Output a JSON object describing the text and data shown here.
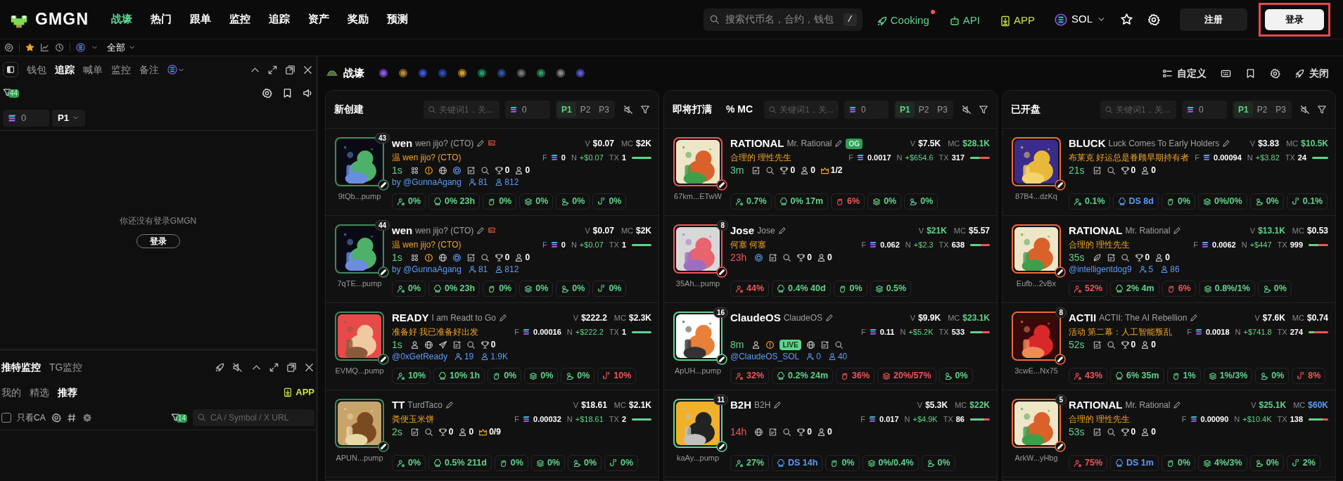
{
  "header": {
    "logo": "GMGN",
    "nav": [
      {
        "label": "战壕",
        "selected": true
      },
      {
        "label": "热门",
        "selected": false
      },
      {
        "label": "跟单",
        "selected": false
      },
      {
        "label": "监控",
        "selected": false
      },
      {
        "label": "追踪",
        "selected": false
      },
      {
        "label": "资产",
        "selected": false
      },
      {
        "label": "奖励",
        "selected": false
      },
      {
        "label": "预测",
        "selected": false
      }
    ],
    "search": {
      "placeholder": "搜索代币名，合约，钱包",
      "shortcut": "/"
    },
    "links": [
      {
        "kind": "cooking",
        "label": "Cooking",
        "dot": true
      },
      {
        "kind": "api",
        "label": "API",
        "dot": false
      },
      {
        "kind": "app",
        "label": "APP",
        "dot": false
      }
    ],
    "chain": "SOL",
    "register": "注册",
    "login": {
      "label": "登录",
      "highlighted": true
    }
  },
  "subbar": {
    "filter": "全部"
  },
  "left_panel": {
    "tabs": [
      {
        "label": "钱包",
        "selected": false
      },
      {
        "label": "追踪",
        "selected": true
      },
      {
        "label": "喊单",
        "selected": false
      },
      {
        "label": "监控",
        "selected": false
      },
      {
        "label": "备注",
        "selected": false
      }
    ],
    "filter_count": "44",
    "amount": "0",
    "page": "P1",
    "message": "你还没有登录GMGN",
    "login_button": "登录"
  },
  "monitor_panel": {
    "tabs": [
      {
        "label": "推特监控",
        "selected": true
      },
      {
        "label": "TG监控",
        "selected": false
      }
    ],
    "subtabs": [
      {
        "label": "我的",
        "selected": false
      },
      {
        "label": "精选",
        "selected": false
      },
      {
        "label": "推荐",
        "selected": true
      }
    ],
    "app": "APP",
    "only_ca": {
      "label": "只看CA",
      "checked": false
    },
    "filter_count": "14",
    "search_placeholder": "CA / Symbol / X URL"
  },
  "main": {
    "title": "战壕",
    "actions": [
      {
        "kind": "customize",
        "label": "自定义"
      },
      {
        "kind": "keyboard"
      },
      {
        "kind": "bookmark"
      },
      {
        "kind": "settings"
      },
      {
        "kind": "close",
        "label": "关闭"
      }
    ],
    "columns": [
      {
        "title": "新创建",
        "search_placeholder": "关键词1，关...",
        "amount": "0",
        "pages": [
          {
            "label": "P1",
            "selected": true
          },
          {
            "label": "P2",
            "selected": false
          },
          {
            "label": "P3",
            "selected": false
          }
        ],
        "cards": [
          {
            "count": "43",
            "color": "#3f8a5c",
            "ticker": "wen",
            "name": "wen jijo? (CTO)",
            "flag": true,
            "subtitle": "温 wen jijo?  (CTO)",
            "age": {
              "text": "1s",
              "color": "#5fd38d"
            },
            "stats": [
              {
                "kind": "holders"
              },
              {
                "kind": "warn"
              },
              {
                "kind": "web"
              },
              {
                "kind": "coin"
              },
              {
                "kind": "post"
              },
              {
                "kind": "search"
              },
              {
                "kind": "trophy",
                "value": "0"
              },
              {
                "kind": "person",
                "value": "0"
              }
            ],
            "handle": "by @GunnaAgang",
            "followers": [
              "81",
              "812"
            ],
            "v": {
              "label": "V",
              "text": "$0.07",
              "color": "#ffffff"
            },
            "mc": {
              "label": "MC",
              "text": "$2K",
              "color": "#ffffff"
            },
            "f": {
              "label": "F",
              "text": "0"
            },
            "n": {
              "label": "N",
              "text": "+$0.07"
            },
            "tx": {
              "label": "TX",
              "text": "1"
            },
            "level": 1,
            "address": "9tQb...pump",
            "chips": [
              {
                "kind": "holders",
                "text": "0%",
                "color": "#5fd38d"
              },
              {
                "kind": "hat",
                "text": "0% 23h",
                "color": "#5fd38d"
              },
              {
                "kind": "fist",
                "text": "0%",
                "color": "#5fd38d"
              },
              {
                "kind": "layers",
                "text": "0%",
                "color": "#5fd38d"
              },
              {
                "kind": "rat",
                "text": "0%",
                "color": "#5fd38d"
              },
              {
                "kind": "hook",
                "text": "0%",
                "color": "#5fd38d"
              }
            ]
          },
          {
            "count": "44",
            "color": "#3f8a5c",
            "ticker": "wen",
            "name": "wen jijo? (CTO)",
            "flag": true,
            "subtitle": "温 wen jijo?  (CTO)",
            "age": {
              "text": "1s",
              "color": "#5fd38d"
            },
            "stats": [
              {
                "kind": "holders"
              },
              {
                "kind": "warn"
              },
              {
                "kind": "web"
              },
              {
                "kind": "coin"
              },
              {
                "kind": "post"
              },
              {
                "kind": "search"
              },
              {
                "kind": "trophy",
                "value": "0"
              },
              {
                "kind": "person",
                "value": "0"
              }
            ],
            "handle": "by @GunnaAgang",
            "followers": [
              "81",
              "812"
            ],
            "v": {
              "label": "V",
              "text": "$0.07",
              "color": "#ffffff"
            },
            "mc": {
              "label": "MC",
              "text": "$2K",
              "color": "#ffffff"
            },
            "f": {
              "label": "F",
              "text": "0"
            },
            "n": {
              "label": "N",
              "text": "+$0.07"
            },
            "tx": {
              "label": "TX",
              "text": "1"
            },
            "level": 1,
            "address": "7qTE...pump",
            "chips": [
              {
                "kind": "holders",
                "text": "0%",
                "color": "#5fd38d"
              },
              {
                "kind": "hat",
                "text": "0% 23h",
                "color": "#5fd38d"
              },
              {
                "kind": "fist",
                "text": "0%",
                "color": "#5fd38d"
              },
              {
                "kind": "layers",
                "text": "0%",
                "color": "#5fd38d"
              },
              {
                "kind": "rat",
                "text": "0%",
                "color": "#5fd38d"
              },
              {
                "kind": "hook",
                "text": "0%",
                "color": "#5fd38d"
              }
            ]
          },
          {
            "color": "#3f8a5c",
            "ticker": "READY",
            "name": "I am Readt to Go",
            "flag": false,
            "subtitle": "准备好 我已准备好出发",
            "age": {
              "text": "1s",
              "color": "#5fd38d"
            },
            "stats": [
              {
                "kind": "person"
              },
              {
                "kind": "web"
              },
              {
                "kind": "telegram"
              },
              {
                "kind": "post"
              },
              {
                "kind": "search"
              },
              {
                "kind": "trophy",
                "value": "0"
              }
            ],
            "handle": "@0xGetReady",
            "followers": [
              "19",
              "1.9K"
            ],
            "v": {
              "label": "V",
              "text": "$222.2",
              "color": "#ffffff"
            },
            "mc": {
              "label": "MC",
              "text": "$2.3K",
              "color": "#ffffff"
            },
            "f": {
              "label": "F",
              "text": "0.00016"
            },
            "n": {
              "label": "N",
              "text": "+$222.2"
            },
            "tx": {
              "label": "TX",
              "text": "1"
            },
            "level": 1,
            "address": "EVMQ...pump",
            "chips": [
              {
                "kind": "holders",
                "text": "10%",
                "color": "#5fd38d"
              },
              {
                "kind": "hat",
                "text": "10% 1h",
                "color": "#5fd38d"
              },
              {
                "kind": "fist",
                "text": "0%",
                "color": "#5fd38d"
              },
              {
                "kind": "layers",
                "text": "0%",
                "color": "#5fd38d"
              },
              {
                "kind": "rat",
                "text": "0%",
                "color": "#5fd38d"
              },
              {
                "kind": "hook",
                "text": "10%",
                "color": "#f0555a"
              }
            ]
          },
          {
            "color": "#3f8a5c",
            "ticker": "TT",
            "name": "TurdTaco",
            "flag": false,
            "subtitle": "粪便玉米饼",
            "age": {
              "text": "2s",
              "color": "#5fd38d"
            },
            "stats": [
              {
                "kind": "post"
              },
              {
                "kind": "search"
              },
              {
                "kind": "trophy",
                "value": "0"
              },
              {
                "kind": "person",
                "value": "0"
              },
              {
                "kind": "crown",
                "value": "0/9"
              }
            ],
            "v": {
              "label": "V",
              "text": "$18.61",
              "color": "#ffffff"
            },
            "mc": {
              "label": "MC",
              "text": "$2.1K",
              "color": "#ffffff"
            },
            "f": {
              "label": "F",
              "text": "0.00032"
            },
            "n": {
              "label": "N",
              "text": "+$18.61"
            },
            "tx": {
              "label": "TX",
              "text": "2"
            },
            "level": 1,
            "address": "APUN...pump",
            "chips": [
              {
                "kind": "holders",
                "text": "0%",
                "color": "#5fd38d"
              },
              {
                "kind": "hat",
                "text": "0.5% 211d",
                "color": "#5fd38d"
              },
              {
                "kind": "fist",
                "text": "0%",
                "color": "#5fd38d"
              },
              {
                "kind": "layers",
                "text": "0%",
                "color": "#5fd38d"
              },
              {
                "kind": "rat",
                "text": "0%",
                "color": "#5fd38d"
              },
              {
                "kind": "hook",
                "text": "0%",
                "color": "#5fd38d"
              }
            ]
          }
        ]
      },
      {
        "title": "即将打满",
        "extra": "% MC",
        "search_placeholder": "关键词1，关...",
        "amount": "0",
        "pages": [
          {
            "label": "P1",
            "selected": true
          },
          {
            "label": "P2",
            "selected": false
          },
          {
            "label": "P3",
            "selected": false
          }
        ],
        "cards": [
          {
            "color": "#f0555a",
            "ticker": "RATIONAL",
            "name": "Mr. Rational",
            "badge": "OG",
            "flag": false,
            "subtitle": "合理的 理性先生",
            "age": {
              "text": "3m",
              "color": "#5fd38d"
            },
            "stats": [
              {
                "kind": "post"
              },
              {
                "kind": "search"
              },
              {
                "kind": "trophy",
                "value": "0"
              },
              {
                "kind": "person",
                "value": "0"
              },
              {
                "kind": "crown",
                "value": "1/2"
              }
            ],
            "v": {
              "label": "V",
              "text": "$7.5K",
              "color": "#ffffff"
            },
            "mc": {
              "label": "MC",
              "text": "$28.1K",
              "color": "#5fd38d"
            },
            "f": {
              "label": "F",
              "text": "0.0017"
            },
            "n": {
              "label": "N",
              "text": "+$654.6"
            },
            "tx": {
              "label": "TX",
              "text": "317"
            },
            "level": 0.45,
            "address": "67km...ETwW",
            "chips": [
              {
                "kind": "holders",
                "text": "0.7%",
                "color": "#5fd38d"
              },
              {
                "kind": "hat",
                "text": "0% 17m",
                "color": "#5fd38d"
              },
              {
                "kind": "fist",
                "text": "6%",
                "color": "#f0555a"
              },
              {
                "kind": "layers",
                "text": "0%",
                "color": "#5fd38d"
              },
              {
                "kind": "rat",
                "text": "0%",
                "color": "#5fd38d"
              }
            ]
          },
          {
            "count": "8",
            "color": "#f0555a",
            "ticker": "Jose",
            "name": "Jose",
            "flag": false,
            "subtitle": "何塞 何塞",
            "age": {
              "text": "23h",
              "color": "#f0555a"
            },
            "stats": [
              {
                "kind": "coin"
              },
              {
                "kind": "post"
              },
              {
                "kind": "search"
              },
              {
                "kind": "trophy",
                "value": "0"
              },
              {
                "kind": "person",
                "value": "0"
              }
            ],
            "v": {
              "label": "V",
              "text": "$21K",
              "color": "#5fd38d"
            },
            "mc": {
              "label": "MC",
              "text": "$5.57",
              "color": "#ffffff"
            },
            "f": {
              "label": "F",
              "text": "0.062"
            },
            "n": {
              "label": "N",
              "text": "+$2.3"
            },
            "tx": {
              "label": "TX",
              "text": "638"
            },
            "level": 0.55,
            "address": "35Ah...pump",
            "chips": [
              {
                "kind": "holders",
                "text": "44%",
                "color": "#f0555a"
              },
              {
                "kind": "hat",
                "text": "0.4% 40d",
                "color": "#5fd38d"
              },
              {
                "kind": "fist",
                "text": "0%",
                "color": "#5fd38d"
              },
              {
                "kind": "layers",
                "text": "0.5%",
                "color": "#5fd38d"
              }
            ]
          },
          {
            "count": "16",
            "color": "#5fd38d",
            "ticker": "ClaudeOS",
            "name": "ClaudeOS",
            "flag": false,
            "age": {
              "text": "8m",
              "color": "#5fd38d"
            },
            "stats": [
              {
                "kind": "person"
              },
              {
                "kind": "warn"
              },
              {
                "kind": "live",
                "value": "LIVE"
              },
              {
                "kind": "web"
              },
              {
                "kind": "post"
              },
              {
                "kind": "search"
              }
            ],
            "handle": "@ClaudeOS_SOL",
            "followers": [
              "0",
              "40"
            ],
            "v": {
              "label": "V",
              "text": "$9.9K",
              "color": "#ffffff"
            },
            "mc": {
              "label": "MC",
              "text": "$23.1K",
              "color": "#5fd38d"
            },
            "f": {
              "label": "F",
              "text": "0.11"
            },
            "n": {
              "label": "N",
              "text": "+$5.2K"
            },
            "tx": {
              "label": "TX",
              "text": "533"
            },
            "level": 0.6,
            "address": "ApUH...pump",
            "chips": [
              {
                "kind": "holders",
                "text": "32%",
                "color": "#f0555a"
              },
              {
                "kind": "hat",
                "text": "0.2% 24m",
                "color": "#5fd38d"
              },
              {
                "kind": "fist",
                "text": "36%",
                "color": "#f0555a"
              },
              {
                "kind": "layers",
                "text": "20%/57%",
                "color": "#f0555a"
              },
              {
                "kind": "rat",
                "text": "0%",
                "color": "#5fd38d"
              }
            ]
          },
          {
            "count": "11",
            "color": "#5fd38d",
            "ticker": "B2H",
            "name": "B2H",
            "flag": false,
            "age": {
              "text": "14h",
              "color": "#f0555a"
            },
            "stats": [
              {
                "kind": "web"
              },
              {
                "kind": "post"
              },
              {
                "kind": "search"
              },
              {
                "kind": "trophy",
                "value": "0"
              },
              {
                "kind": "person",
                "value": "0"
              }
            ],
            "v": {
              "label": "V",
              "text": "$5.3K",
              "color": "#ffffff"
            },
            "mc": {
              "label": "MC",
              "text": "$22K",
              "color": "#5fd38d"
            },
            "f": {
              "label": "F",
              "text": "0.017"
            },
            "n": {
              "label": "N",
              "text": "+$4.9K"
            },
            "tx": {
              "label": "TX",
              "text": "86"
            },
            "level": 0.7,
            "address": "kaAy...pump",
            "chips": [
              {
                "kind": "holders",
                "text": "27%",
                "color": "#5fd38d"
              },
              {
                "kind": "hat",
                "text": "DS 14h",
                "color": "#5b9cf5"
              },
              {
                "kind": "fist",
                "text": "0%",
                "color": "#5fd38d"
              },
              {
                "kind": "layers",
                "text": "0%/0.4%",
                "color": "#5fd38d"
              },
              {
                "kind": "rat",
                "text": "0%",
                "color": "#5fd38d"
              }
            ]
          }
        ]
      },
      {
        "title": "已开盘",
        "search_placeholder": "关键词1，关...",
        "amount": "0",
        "pages": [
          {
            "label": "P1",
            "selected": true
          },
          {
            "label": "P2",
            "selected": false
          },
          {
            "label": "P3",
            "selected": false
          }
        ],
        "cards": [
          {
            "color": "#f06a3a",
            "ticker": "BLUCK",
            "name": "Luck Comes To Early Holders",
            "flag": false,
            "subtitle": "布莱克 好运总是眷顾早期持有者",
            "age": {
              "text": "21s",
              "color": "#5fd38d"
            },
            "stats": [
              {
                "kind": "post"
              },
              {
                "kind": "search"
              },
              {
                "kind": "trophy",
                "value": "0"
              },
              {
                "kind": "person",
                "value": "0"
              }
            ],
            "v": {
              "label": "V",
              "text": "$3.83",
              "color": "#ffffff"
            },
            "mc": {
              "label": "MC",
              "text": "$10.5K",
              "color": "#5fd38d"
            },
            "f": {
              "label": "F",
              "text": "0.00094"
            },
            "n": {
              "label": "N",
              "text": "+$3.82"
            },
            "tx": {
              "label": "TX",
              "text": "24"
            },
            "level": 1,
            "address": "87B4...dzKq",
            "chips": [
              {
                "kind": "holders",
                "text": "0.1%",
                "color": "#5fd38d"
              },
              {
                "kind": "hat",
                "text": "DS 8d",
                "color": "#5b9cf5"
              },
              {
                "kind": "fist",
                "text": "0%",
                "color": "#5fd38d"
              },
              {
                "kind": "layers",
                "text": "0%/0%",
                "color": "#5fd38d"
              },
              {
                "kind": "rat",
                "text": "0%",
                "color": "#5fd38d"
              },
              {
                "kind": "hook",
                "text": "0.1%",
                "color": "#5fd38d"
              }
            ]
          },
          {
            "color": "#f06a3a",
            "ticker": "RATIONAL",
            "name": "Mr. Rational",
            "flag": false,
            "subtitle": "合理的 理性先生",
            "age": {
              "text": "35s",
              "color": "#5fd38d"
            },
            "stats": [
              {
                "kind": "leaf"
              },
              {
                "kind": "post"
              },
              {
                "kind": "search"
              },
              {
                "kind": "trophy",
                "value": "0"
              },
              {
                "kind": "person",
                "value": "0"
              }
            ],
            "handle": "@intelligentdog9",
            "followers": [
              "5",
              "86"
            ],
            "v": {
              "label": "V",
              "text": "$13.1K",
              "color": "#5fd38d"
            },
            "mc": {
              "label": "MC",
              "text": "$0.53",
              "color": "#ffffff"
            },
            "f": {
              "label": "F",
              "text": "0.0062"
            },
            "n": {
              "label": "N",
              "text": "+$447"
            },
            "tx": {
              "label": "TX",
              "text": "999"
            },
            "level": 0.5,
            "address": "Eufb...2vBx",
            "chips": [
              {
                "kind": "holders",
                "text": "52%",
                "color": "#f0555a"
              },
              {
                "kind": "hat",
                "text": "2% 4m",
                "color": "#5fd38d"
              },
              {
                "kind": "fist",
                "text": "6%",
                "color": "#f0555a"
              },
              {
                "kind": "layers",
                "text": "0.8%/1%",
                "color": "#5fd38d"
              },
              {
                "kind": "rat",
                "text": "0%",
                "color": "#5fd38d"
              }
            ]
          },
          {
            "count": "8",
            "color": "#f06a3a",
            "ticker": "ACTII",
            "name": "ACTII: The AI Rebellion",
            "flag": false,
            "subtitle": "活动 第二幕：人工智能叛乱",
            "age": {
              "text": "52s",
              "color": "#5fd38d"
            },
            "stats": [
              {
                "kind": "post"
              },
              {
                "kind": "search"
              },
              {
                "kind": "trophy",
                "value": "0"
              },
              {
                "kind": "person",
                "value": "0"
              }
            ],
            "v": {
              "label": "V",
              "text": "$7.6K",
              "color": "#ffffff"
            },
            "mc": {
              "label": "MC",
              "text": "$0.74",
              "color": "#ffffff"
            },
            "f": {
              "label": "F",
              "text": "0.0018"
            },
            "n": {
              "label": "N",
              "text": "+$741.8"
            },
            "tx": {
              "label": "TX",
              "text": "274"
            },
            "level": 0.3,
            "address": "3cwE...Nx75",
            "chips": [
              {
                "kind": "holders",
                "text": "43%",
                "color": "#f0555a"
              },
              {
                "kind": "hat",
                "text": "6% 35m",
                "color": "#5fd38d"
              },
              {
                "kind": "fist",
                "text": "1%",
                "color": "#5fd38d"
              },
              {
                "kind": "layers",
                "text": "1%/3%",
                "color": "#5fd38d"
              },
              {
                "kind": "rat",
                "text": "0%",
                "color": "#5fd38d"
              },
              {
                "kind": "hook",
                "text": "8%",
                "color": "#f0555a"
              }
            ]
          },
          {
            "count": "5",
            "color": "#f06a3a",
            "ticker": "RATIONAL",
            "name": "Mr. Rational",
            "flag": false,
            "subtitle": "合理的 理性先生",
            "age": {
              "text": "53s",
              "color": "#5fd38d"
            },
            "stats": [
              {
                "kind": "post"
              },
              {
                "kind": "search"
              },
              {
                "kind": "trophy",
                "value": "0"
              },
              {
                "kind": "person",
                "value": "0"
              }
            ],
            "v": {
              "label": "V",
              "text": "$25.1K",
              "color": "#5fd38d"
            },
            "mc": {
              "label": "MC",
              "text": "$60K",
              "color": "#5b9cf5"
            },
            "f": {
              "label": "F",
              "text": "0.00090"
            },
            "n": {
              "label": "N",
              "text": "+$10.4K"
            },
            "tx": {
              "label": "TX",
              "text": "138"
            },
            "level": 0.7,
            "address": "ArkW...yHbg",
            "chips": [
              {
                "kind": "holders",
                "text": "75%",
                "color": "#f0555a"
              },
              {
                "kind": "hat",
                "text": "DS 1m",
                "color": "#5b9cf5"
              },
              {
                "kind": "fist",
                "text": "0%",
                "color": "#5fd38d"
              },
              {
                "kind": "layers",
                "text": "4%/3%",
                "color": "#5fd38d"
              },
              {
                "kind": "rat",
                "text": "0%",
                "color": "#5fd38d"
              },
              {
                "kind": "hook",
                "text": "2%",
                "color": "#5fd38d"
              }
            ]
          }
        ]
      }
    ]
  }
}
